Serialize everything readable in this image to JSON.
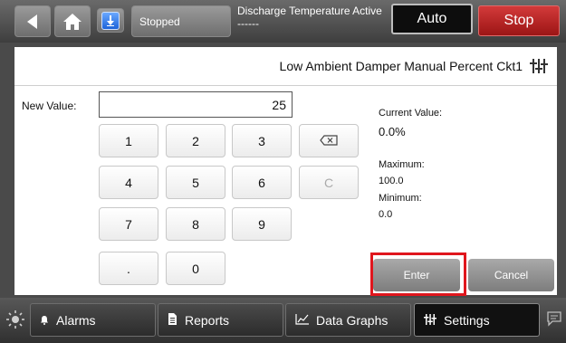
{
  "topbar": {
    "status": "Stopped",
    "discharge_title": "Discharge Temperature Active",
    "discharge_value": "------",
    "auto_label": "Auto",
    "stop_label": "Stop",
    "icons": [
      "back-icon",
      "home-icon",
      "download-icon"
    ]
  },
  "panel": {
    "title": "Low Ambient Damper Manual Percent Ckt1",
    "new_value_label": "New Value:",
    "new_value": "25",
    "keypad": [
      "1",
      "2",
      "3",
      "⌫",
      "4",
      "5",
      "6",
      "C",
      "7",
      "8",
      "9",
      ".",
      "0"
    ],
    "current_value_label": "Current Value:",
    "current_value": "0.0%",
    "maximum_label": "Maximum:",
    "maximum_value": "100.0",
    "minimum_label": "Minimum:",
    "minimum_value": "0.0",
    "enter_label": "Enter",
    "cancel_label": "Cancel"
  },
  "bottombar": {
    "tabs": [
      {
        "label": "Alarms",
        "icon": "bell-icon"
      },
      {
        "label": "Reports",
        "icon": "report-icon"
      },
      {
        "label": "Data Graphs",
        "icon": "graph-icon"
      },
      {
        "label": "Settings",
        "icon": "settings-icon",
        "active": true
      }
    ]
  },
  "colors": {
    "stop": "#b52020",
    "highlight": "#e0161d",
    "active_tab": "#111111"
  }
}
